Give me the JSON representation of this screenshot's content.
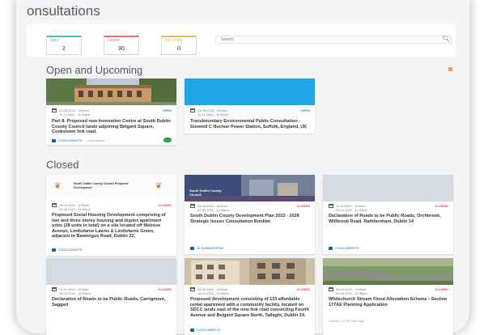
{
  "header": {
    "title": "onsultations"
  },
  "stats": [
    {
      "label": "Open",
      "count": "2",
      "color": "#4fc3a1"
    },
    {
      "label": "Closed",
      "count": "90",
      "color": "#e57373"
    },
    {
      "label": "Upcoming",
      "count": "0",
      "color": "#f0b95a"
    }
  ],
  "search": {
    "placeholder": "Search"
  },
  "sections": {
    "open_upcoming": "Open and Upcoming",
    "closed": "Closed"
  },
  "open_cards": [
    {
      "dates": [
        "30.05.2024 - 9:00am",
        "11.11.2024 - 11:59pm"
      ],
      "status": "OPEN",
      "title": "Part 8- Proposed new Innovation Centre at South Dublin County Council lands adjoining Belgard Square, Cookstown link road.",
      "footer_primary": "3 DOCUMENTS",
      "footer_secondary": "Consultation",
      "image": "building-photo"
    },
    {
      "dates": [
        "21.05.2024 - 9:00am",
        "11.11.2024 - 11:59pm"
      ],
      "status": "OPEN",
      "title": "Transboundary Environmental Public Consultation - Sizewell C Nuclear Power Station, Suffolk, England, UK",
      "footer_primary": "",
      "footer_secondary": "",
      "image": "blue-banner"
    }
  ],
  "closed_cards": [
    {
      "logo_text": "South Dublin County Council Proposed Development",
      "dates": [
        "18.04.2024 - 9:00am",
        "21.05.2024 - 11:59pm"
      ],
      "status": "CLOSED",
      "title": "Proposed Social Housing Development comprising of two and three storey housing and duplex apartment units (28 units in total) on a site located off Melrose Avenue, Lindisfarne Lawns & Lindisfarne Green, adjacent to Bawnogue Road, Dublin 22.",
      "footer_primary": "3 DOCUMENTS"
    },
    {
      "logo_text": "South Dublin County Council",
      "dates": [
        "04.03.2024 - 9:00am",
        "02.05.2024 - 11:59pm"
      ],
      "status": "CLOSED",
      "title": "South Dublin County Development Plan 2022 - 2028 Strategic Issues Consultation Booklet",
      "footer_primary": "28 SUBMISSIONS"
    },
    {
      "dates": [
        "11.04.2024 - 9:00am",
        "25.04.2024 - 11:59pm"
      ],
      "status": "CLOSED",
      "title": "Declaration of Roads to be Public Roads, Orchbrook, Willbrook Road, Rathfarnham, Dublin 14",
      "footer_primary": "3 DOCUMENTS"
    },
    {
      "dates": [
        "11.04.2024 - 9:00am",
        "25.04.2024 - 11:59pm"
      ],
      "status": "CLOSED",
      "title": "Declaration of Roads to be Public Roads, Carrigmore, Saggart",
      "footer_primary": ""
    },
    {
      "dates": [
        "05.03.2024 - 9:00am",
        "16.04.2024 - 11:59pm"
      ],
      "status": "CLOSED",
      "title": "Proposed development consisting of 133 affordable rental apartment with a community facility, located on SDCC lands east of the new link road connecting Fourth Avenue and Belgard Square North, Tallaght, Dublin 24.",
      "footer_primary": "3 DOCUMENTS"
    },
    {
      "dates": [
        "20.02.2024 - 9:00am",
        "03.04.2024 - 11:59pm"
      ],
      "status": "CLOSED",
      "title": "Whitechurch Stream Flood Alleviation Scheme - Section 177AE Planning Application",
      "footer_primary": "",
      "footer_secondary": "Section 177AE Planning"
    }
  ],
  "colors": {
    "open": "#1e9c8a",
    "closed": "#d64550",
    "link": "#1a5fa8",
    "blue_banner": "#1ea7e8",
    "orange_dot": "#f2994a"
  }
}
